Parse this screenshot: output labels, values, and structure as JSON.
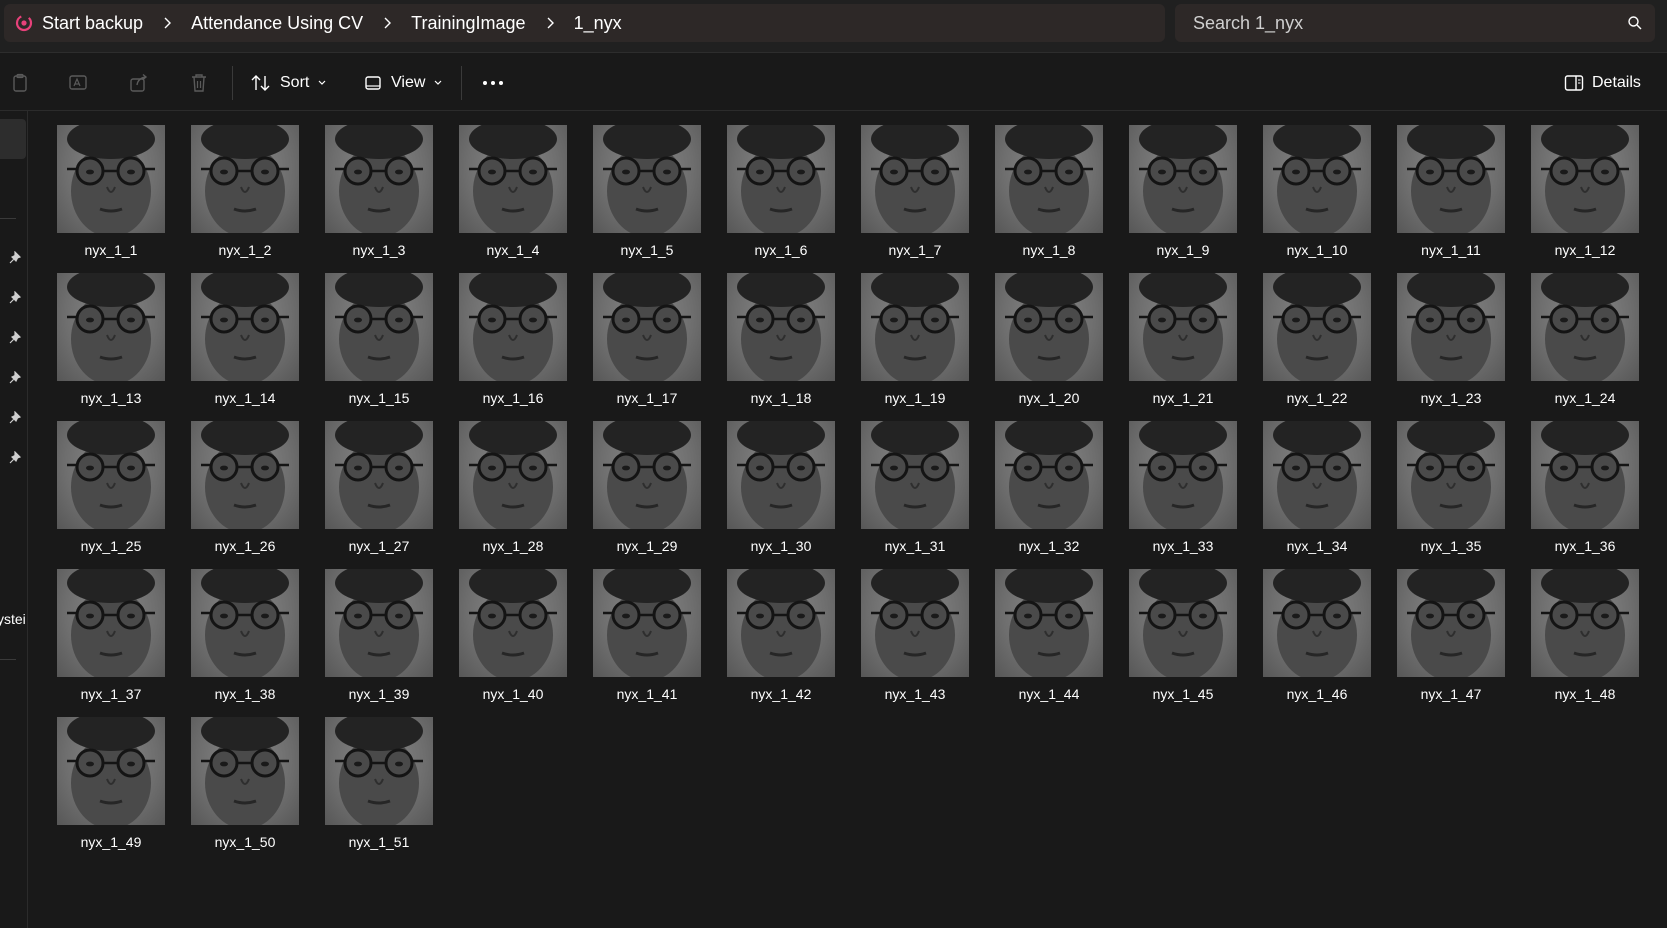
{
  "breadcrumb": {
    "backup_label": "Start backup",
    "items": [
      "Attendance Using CV",
      "TrainingImage",
      "1_nyx"
    ]
  },
  "search": {
    "placeholder": "Search 1_nyx"
  },
  "toolbar": {
    "sort_label": "Sort",
    "view_label": "View",
    "details_label": "Details"
  },
  "nav": {
    "truncated_label": "ystei"
  },
  "colors": {
    "backup_accent": "#e8417a",
    "window_bg": "#191919",
    "bar_bg": "#2d2827"
  },
  "files": [
    "nyx_1_1",
    "nyx_1_2",
    "nyx_1_3",
    "nyx_1_4",
    "nyx_1_5",
    "nyx_1_6",
    "nyx_1_7",
    "nyx_1_8",
    "nyx_1_9",
    "nyx_1_10",
    "nyx_1_11",
    "nyx_1_12",
    "nyx_1_13",
    "nyx_1_14",
    "nyx_1_15",
    "nyx_1_16",
    "nyx_1_17",
    "nyx_1_18",
    "nyx_1_19",
    "nyx_1_20",
    "nyx_1_21",
    "nyx_1_22",
    "nyx_1_23",
    "nyx_1_24",
    "nyx_1_25",
    "nyx_1_26",
    "nyx_1_27",
    "nyx_1_28",
    "nyx_1_29",
    "nyx_1_30",
    "nyx_1_31",
    "nyx_1_32",
    "nyx_1_33",
    "nyx_1_34",
    "nyx_1_35",
    "nyx_1_36",
    "nyx_1_37",
    "nyx_1_38",
    "nyx_1_39",
    "nyx_1_40",
    "nyx_1_41",
    "nyx_1_42",
    "nyx_1_43",
    "nyx_1_44",
    "nyx_1_45",
    "nyx_1_46",
    "nyx_1_47",
    "nyx_1_48",
    "nyx_1_49",
    "nyx_1_50",
    "nyx_1_51"
  ]
}
